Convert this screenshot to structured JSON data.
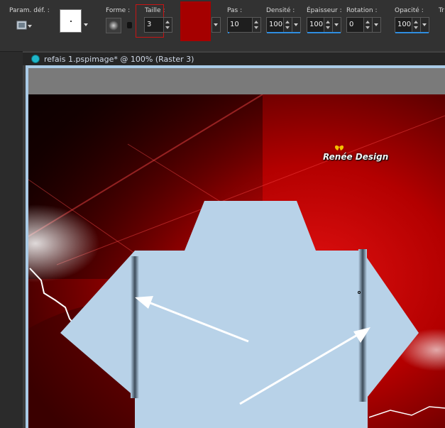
{
  "toolbar": {
    "preset_label": "Param. déf. :",
    "shape_label": "Forme :",
    "size_label": "Taille :",
    "size_value": "3",
    "step_label": "Pas :",
    "step_value": "10",
    "density_label": "Densité :",
    "density_value": "100",
    "thickness_label": "Épaisseur :",
    "thickness_value": "100",
    "rotation_label": "Rotation :",
    "rotation_value": "0",
    "opacity_label": "Opacité :",
    "opacity_value": "100",
    "trailing_label": "Tr"
  },
  "document": {
    "title": "refais 1.pspimage* @ 100% (Raster 3)"
  },
  "canvas": {
    "logo_text": "Renée Design"
  },
  "colors": {
    "accent_blue": "#2f8de0",
    "highlight_red": "#c81414",
    "swatch_red": "#a50000",
    "shirt_fill": "#b8d2e8",
    "background_red": "#b00000"
  },
  "icons": [
    "preset-icon",
    "brush-shape-icon",
    "document-icon",
    "butterfly-icon"
  ]
}
